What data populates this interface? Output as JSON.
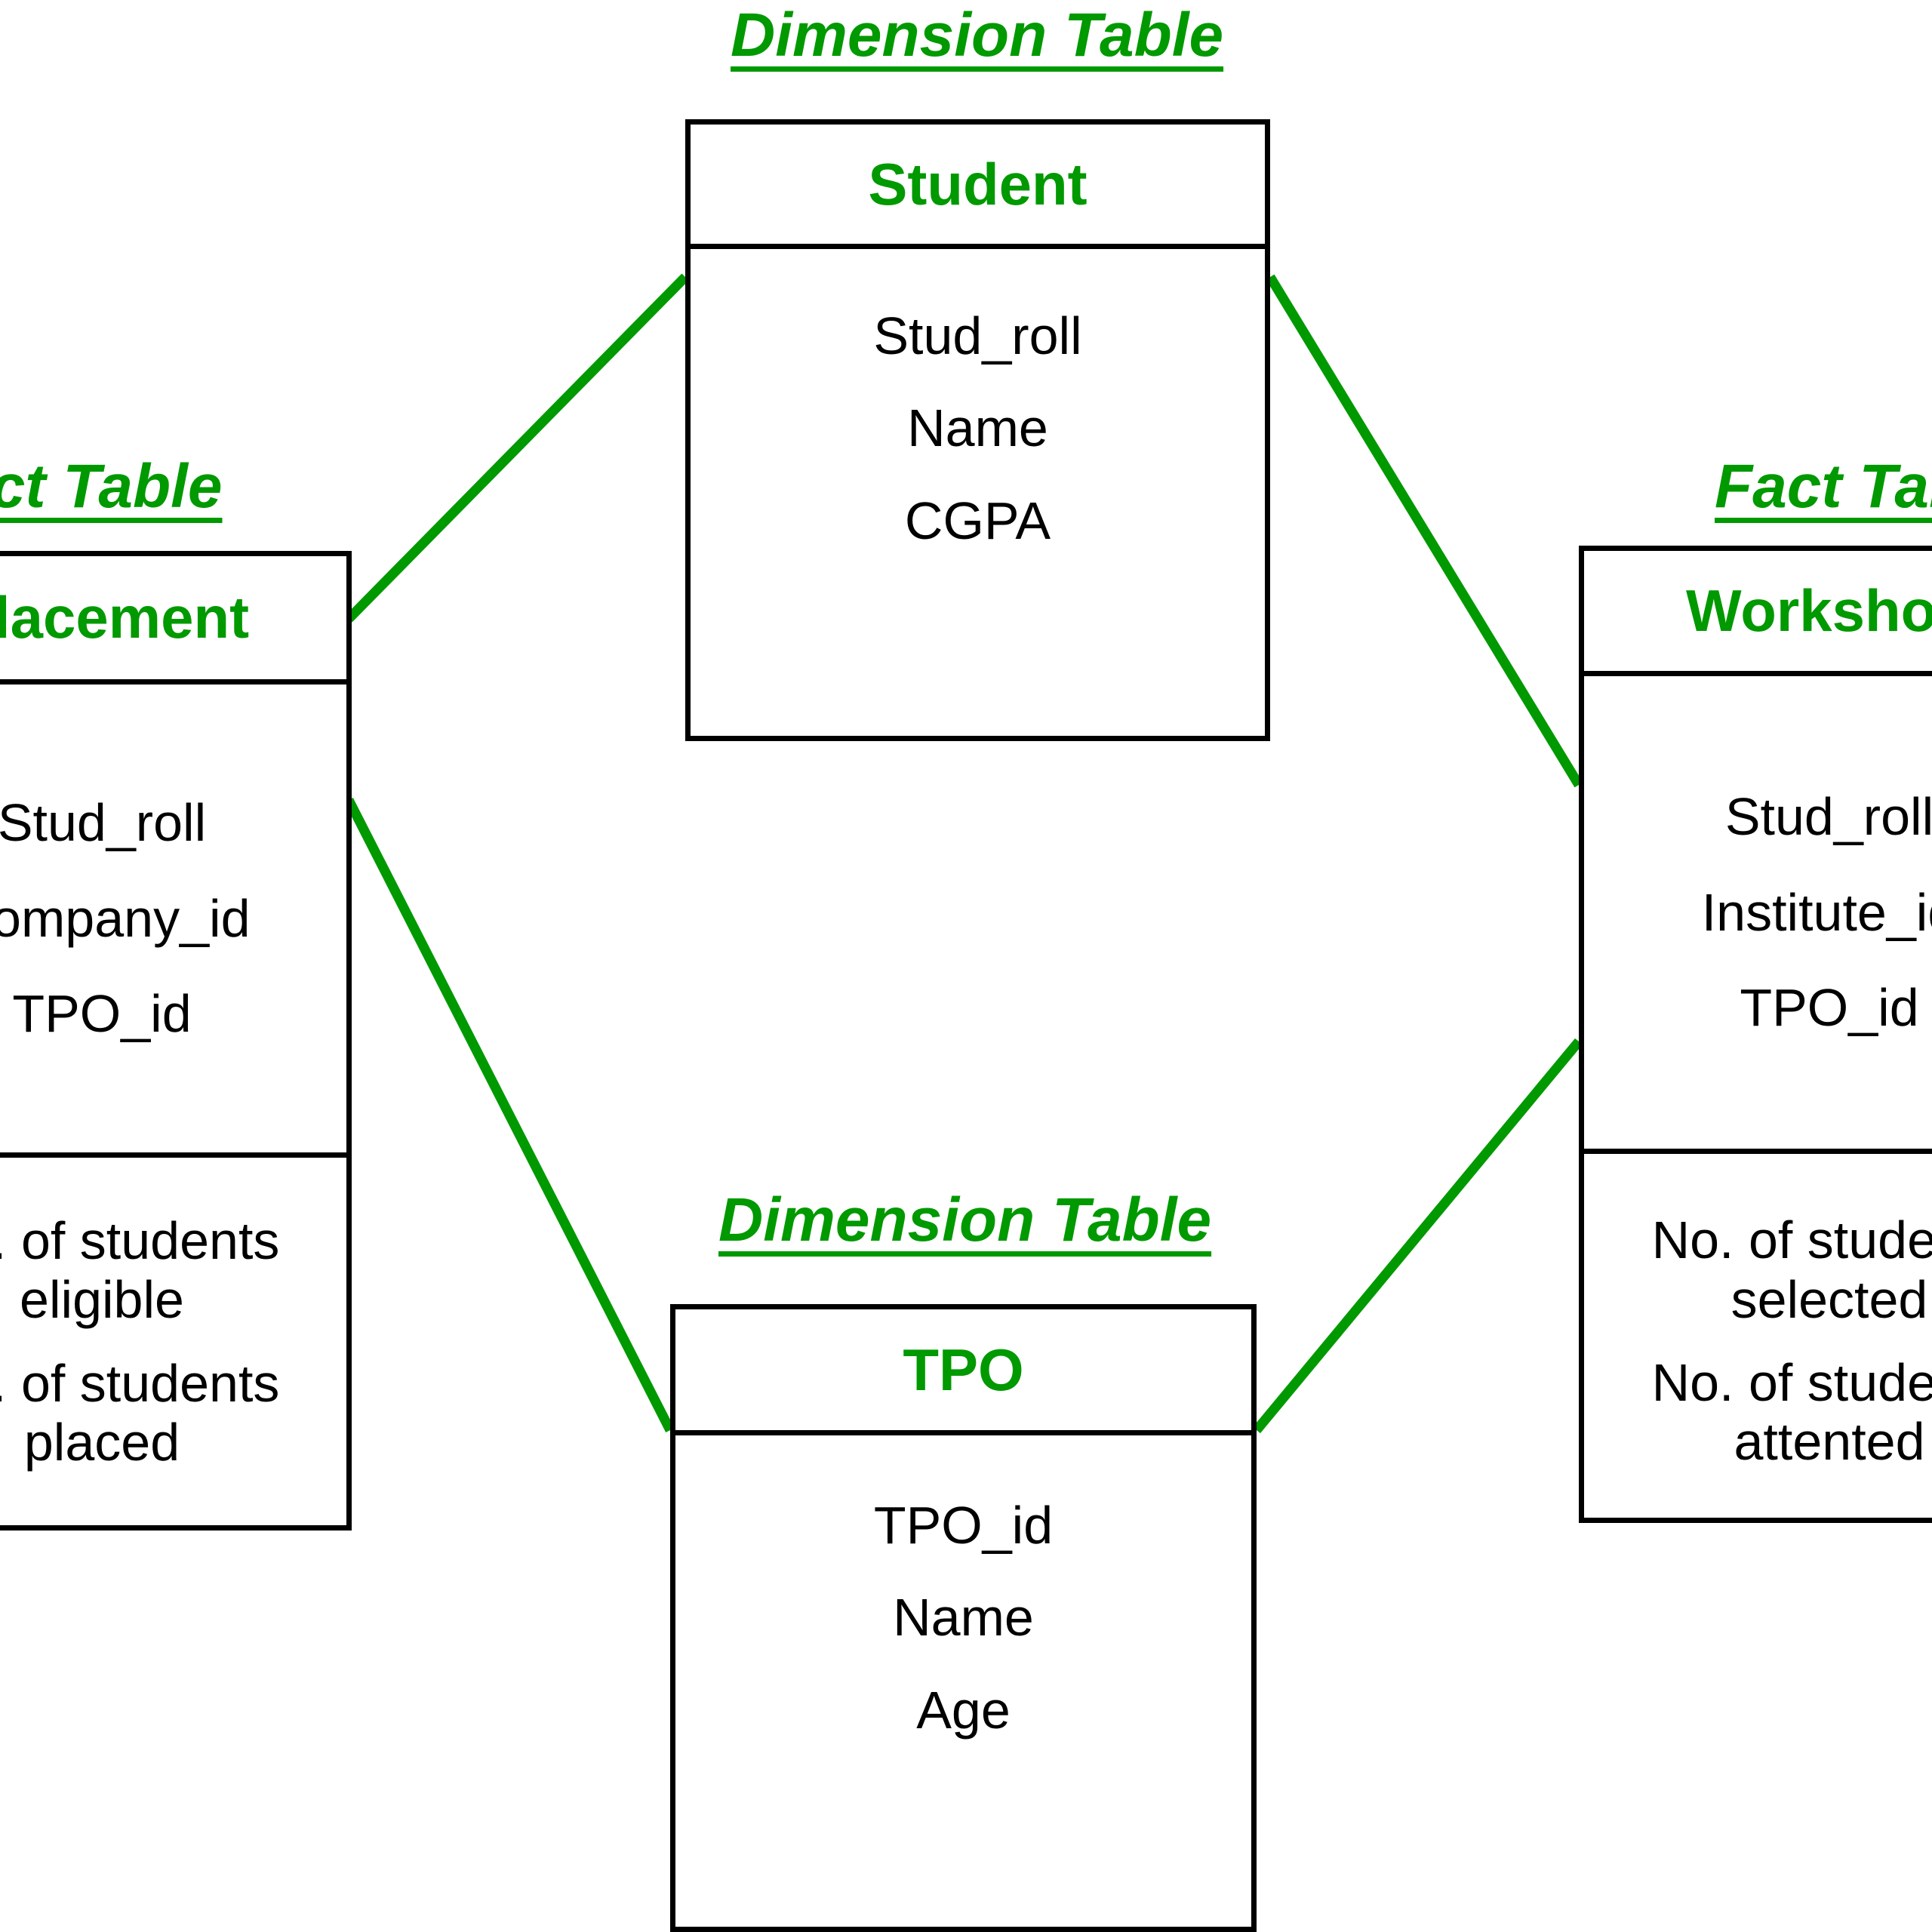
{
  "diagram": {
    "type": "star-schema",
    "accent_color": "#009900",
    "line_color": "#000000",
    "link_color": "#009900"
  },
  "captions": {
    "student": "Dimension Table",
    "tpo": "Dimension Table",
    "placement": "Fact Table",
    "workshop": "Fact Table"
  },
  "tables": {
    "placement": {
      "title": "Placement",
      "keys": [
        "Stud_roll",
        "Company_id",
        "TPO_id"
      ],
      "measures": [
        "No. of students\neligible",
        "No. of students\nplaced"
      ]
    },
    "student": {
      "title": "Student",
      "attributes": [
        "Stud_roll",
        "Name",
        "CGPA"
      ]
    },
    "tpo": {
      "title": "TPO",
      "attributes": [
        "TPO_id",
        "Name",
        "Age"
      ]
    },
    "workshop": {
      "title": "Workshop",
      "keys": [
        "Stud_roll",
        "Institute_id",
        "TPO_id"
      ],
      "measures": [
        "No. of students\nselected",
        "No. of students\nattented"
      ]
    }
  },
  "links": [
    {
      "from": "placement",
      "to": "student"
    },
    {
      "from": "student",
      "to": "workshop"
    },
    {
      "from": "placement",
      "to": "tpo"
    },
    {
      "from": "tpo",
      "to": "workshop"
    }
  ]
}
